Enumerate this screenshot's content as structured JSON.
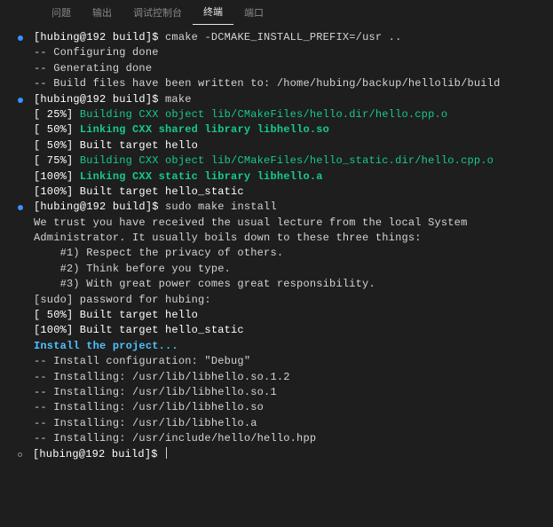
{
  "tabs": {
    "problems": "问题",
    "output": "输出",
    "debug": "调试控制台",
    "terminal": "终端",
    "ports": "端口"
  },
  "prompt": "[hubing@192 build]$ ",
  "lines": {
    "c1": "cmake -DCMAKE_INSTALL_PREFIX=/usr ..",
    "c2": "-- Configuring done",
    "c3": "-- Generating done",
    "c4": "-- Build files have been written to: /home/hubing/backup/hellolib/build",
    "c5": "make",
    "c6a": "[ 25%] ",
    "c6b": "Building CXX object lib/CMakeFiles/hello.dir/hello.cpp.o",
    "c7a": "[ 50%] ",
    "c7b": "Linking CXX shared library libhello.so",
    "c8": "[ 50%] Built target hello",
    "c9a": "[ 75%] ",
    "c9b": "Building CXX object lib/CMakeFiles/hello_static.dir/hello.cpp.o",
    "c10a": "[100%] ",
    "c10b": "Linking CXX static library libhello.a",
    "c11": "[100%] Built target hello_static",
    "c12": "sudo make install",
    "c13": "",
    "c14": "We trust you have received the usual lecture from the local System",
    "c15": "Administrator. It usually boils down to these three things:",
    "c16": "",
    "c17": "    #1) Respect the privacy of others.",
    "c18": "    #2) Think before you type.",
    "c19": "    #3) With great power comes great responsibility.",
    "c20": "",
    "c21": "[sudo] password for hubing:",
    "c22": "[ 50%] Built target hello",
    "c23": "[100%] Built target hello_static",
    "c24": "Install the project...",
    "c25": "-- Install configuration: \"Debug\"",
    "c26": "-- Installing: /usr/lib/libhello.so.1.2",
    "c27": "-- Installing: /usr/lib/libhello.so.1",
    "c28": "-- Installing: /usr/lib/libhello.so",
    "c29": "-- Installing: /usr/lib/libhello.a",
    "c30": "-- Installing: /usr/include/hello/hello.hpp"
  }
}
